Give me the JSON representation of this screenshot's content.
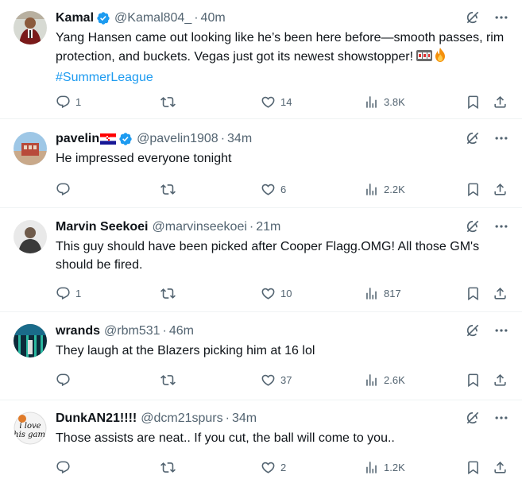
{
  "colors": {
    "accent": "#1d9bf0",
    "text": "#0f1419",
    "muted": "#536471",
    "border": "#eff3f4"
  },
  "tweets": [
    {
      "name": "Kamal",
      "handle": "@Kamal804_",
      "time": "40m",
      "text": "Yang Hansen came out looking like he’s been here before—smooth passes, rim protection, and buckets. Vegas just got its newest showstopper! ",
      "hashtag": "#SummerLeague",
      "replies": "1",
      "reposts": "",
      "likes": "14",
      "views": "3.8K",
      "verified": true
    },
    {
      "name": "pavelin",
      "handle": "@pavelin1908",
      "time": "34m",
      "text": "He impressed everyone tonight",
      "replies": "",
      "reposts": "",
      "likes": "6",
      "views": "2.2K",
      "verified": true,
      "flag": "croatia"
    },
    {
      "name": "Marvin Seekoei",
      "handle": "@marvinseekoei",
      "time": "21m",
      "text": "This guy should have been picked after Cooper Flagg.OMG! All those GM's should be fired.",
      "replies": "1",
      "reposts": "",
      "likes": "10",
      "views": "817"
    },
    {
      "name": "wrands",
      "handle": "@rbm531",
      "time": "46m",
      "text": "They laugh at the Blazers picking him at 16 lol",
      "replies": "",
      "reposts": "",
      "likes": "37",
      "views": "2.6K"
    },
    {
      "name": "DunkAN21!!!!",
      "handle": "@dcm21spurs",
      "time": "34m",
      "text": "Those assists are neat.. If you cut, the ball will come to you..",
      "replies": "",
      "reposts": "",
      "likes": "2",
      "views": "1.2K"
    }
  ],
  "icons": [
    "verified-icon",
    "grok-icon",
    "more-icon",
    "reply-icon",
    "repost-icon",
    "like-icon",
    "views-icon",
    "bookmark-icon",
    "share-icon",
    "slot-machine-icon",
    "fire-icon",
    "croatia-flag-icon"
  ]
}
